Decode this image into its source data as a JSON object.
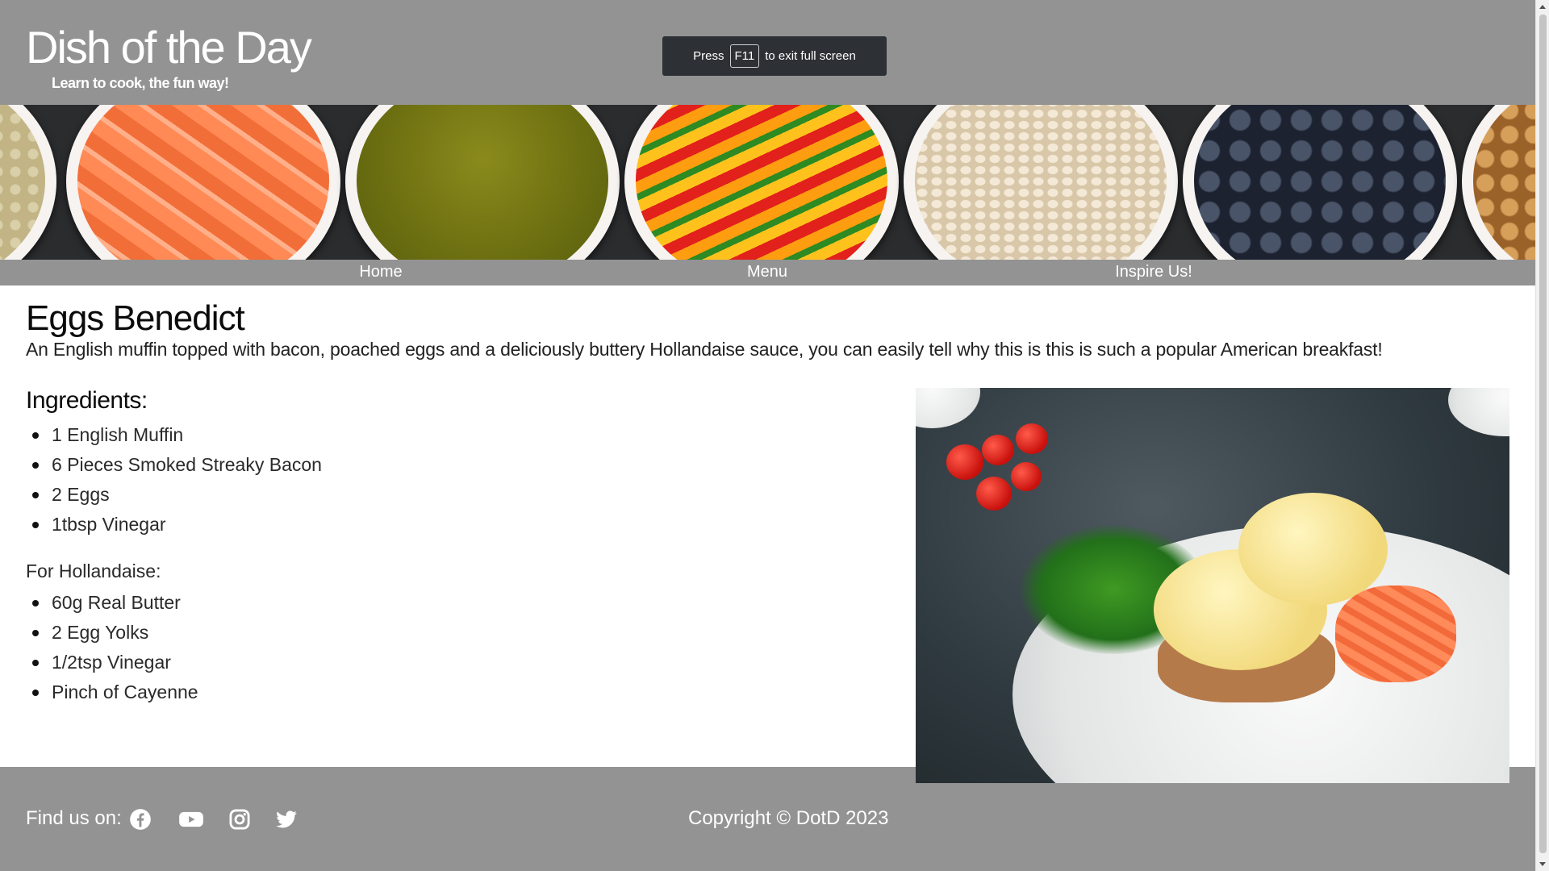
{
  "header": {
    "site_title": "Dish of the Day",
    "tagline": "Learn to cook, the fun way!"
  },
  "fullscreen_notice": {
    "before": "Press",
    "key": "F11",
    "after": "to exit full screen"
  },
  "nav": {
    "items": [
      {
        "label": "Home"
      },
      {
        "label": "Menu"
      },
      {
        "label": "Inspire Us!"
      }
    ]
  },
  "recipe": {
    "title": "Eggs Benedict",
    "description": "An English muffin topped with bacon, poached eggs and a deliciously buttery Hollandaise sauce, you can easily tell why this is this is such a popular American breakfast!",
    "ingredients_heading": "Ingredients:",
    "ingredients": [
      "1 English Muffin",
      "6 Pieces Smoked Streaky Bacon",
      "2 Eggs",
      "1tbsp Vinegar"
    ],
    "hollandaise_heading": "For Hollandaise:",
    "hollandaise": [
      "60g Real Butter",
      "2 Egg Yolks",
      "1/2tsp Vinegar",
      "Pinch of Cayenne"
    ]
  },
  "footer": {
    "find_us": "Find us on:",
    "social_icons": [
      "facebook-icon",
      "youtube-icon",
      "instagram-icon",
      "twitter-icon"
    ],
    "copyright": "Copyright © DotD 2023"
  },
  "colors": {
    "header_bg": "#939393",
    "text_white": "#ffffff",
    "toast_bg": "#2d3035"
  }
}
